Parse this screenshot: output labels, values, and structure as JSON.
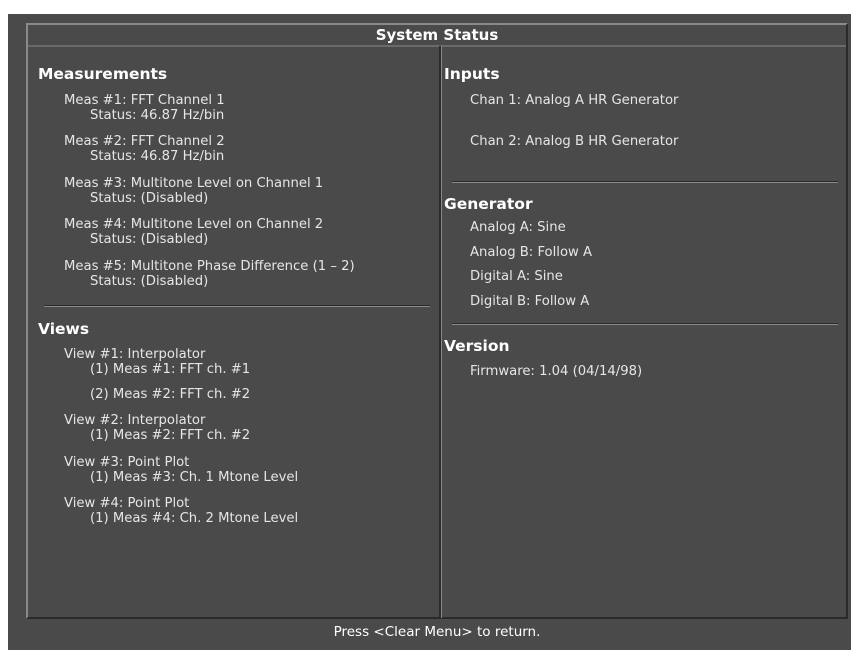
{
  "title": "System Status",
  "measurements": {
    "heading": "Measurements",
    "items": [
      {
        "label": "Meas #1:  FFT Channel 1",
        "status": "Status:  46.87 Hz/bin"
      },
      {
        "label": "Meas #2:  FFT Channel 2",
        "status": "Status:  46.87 Hz/bin"
      },
      {
        "label": "Meas #3:  Multitone Level on Channel 1",
        "status": "Status:  (Disabled)"
      },
      {
        "label": "Meas #4:  Multitone Level on Channel 2",
        "status": "Status:  (Disabled)"
      },
      {
        "label": "Meas #5:  Multitone Phase Difference (1 – 2)",
        "status": "Status:  (Disabled)"
      }
    ]
  },
  "views": {
    "heading": "Views",
    "items": [
      {
        "label": "View #1: Interpolator",
        "meas": [
          "(1) Meas #1:  FFT ch. #1",
          "(2) Meas #2:  FFT ch. #2"
        ]
      },
      {
        "label": "View #2: Interpolator",
        "meas": [
          "(1) Meas #2:  FFT ch. #2"
        ]
      },
      {
        "label": "View #3: Point Plot",
        "meas": [
          "(1) Meas #3:  Ch. 1 Mtone Level"
        ]
      },
      {
        "label": "View #4: Point Plot",
        "meas": [
          "(1) Meas #4:  Ch. 2 Mtone Level"
        ]
      }
    ]
  },
  "inputs": {
    "heading": "Inputs",
    "chan1": "Chan 1:  Analog A HR Generator",
    "chan2": "Chan 2:  Analog B HR Generator"
  },
  "generator": {
    "heading": "Generator",
    "analog_a": "Analog A:  Sine",
    "analog_b": "Analog B:  Follow A",
    "digital_a": "Digital A:  Sine",
    "digital_b": "Digital B:  Follow A"
  },
  "version": {
    "heading": "Version",
    "firmware": "Firmware:  1.04 (04/14/98)"
  },
  "footer": "Press <Clear Menu> to return."
}
